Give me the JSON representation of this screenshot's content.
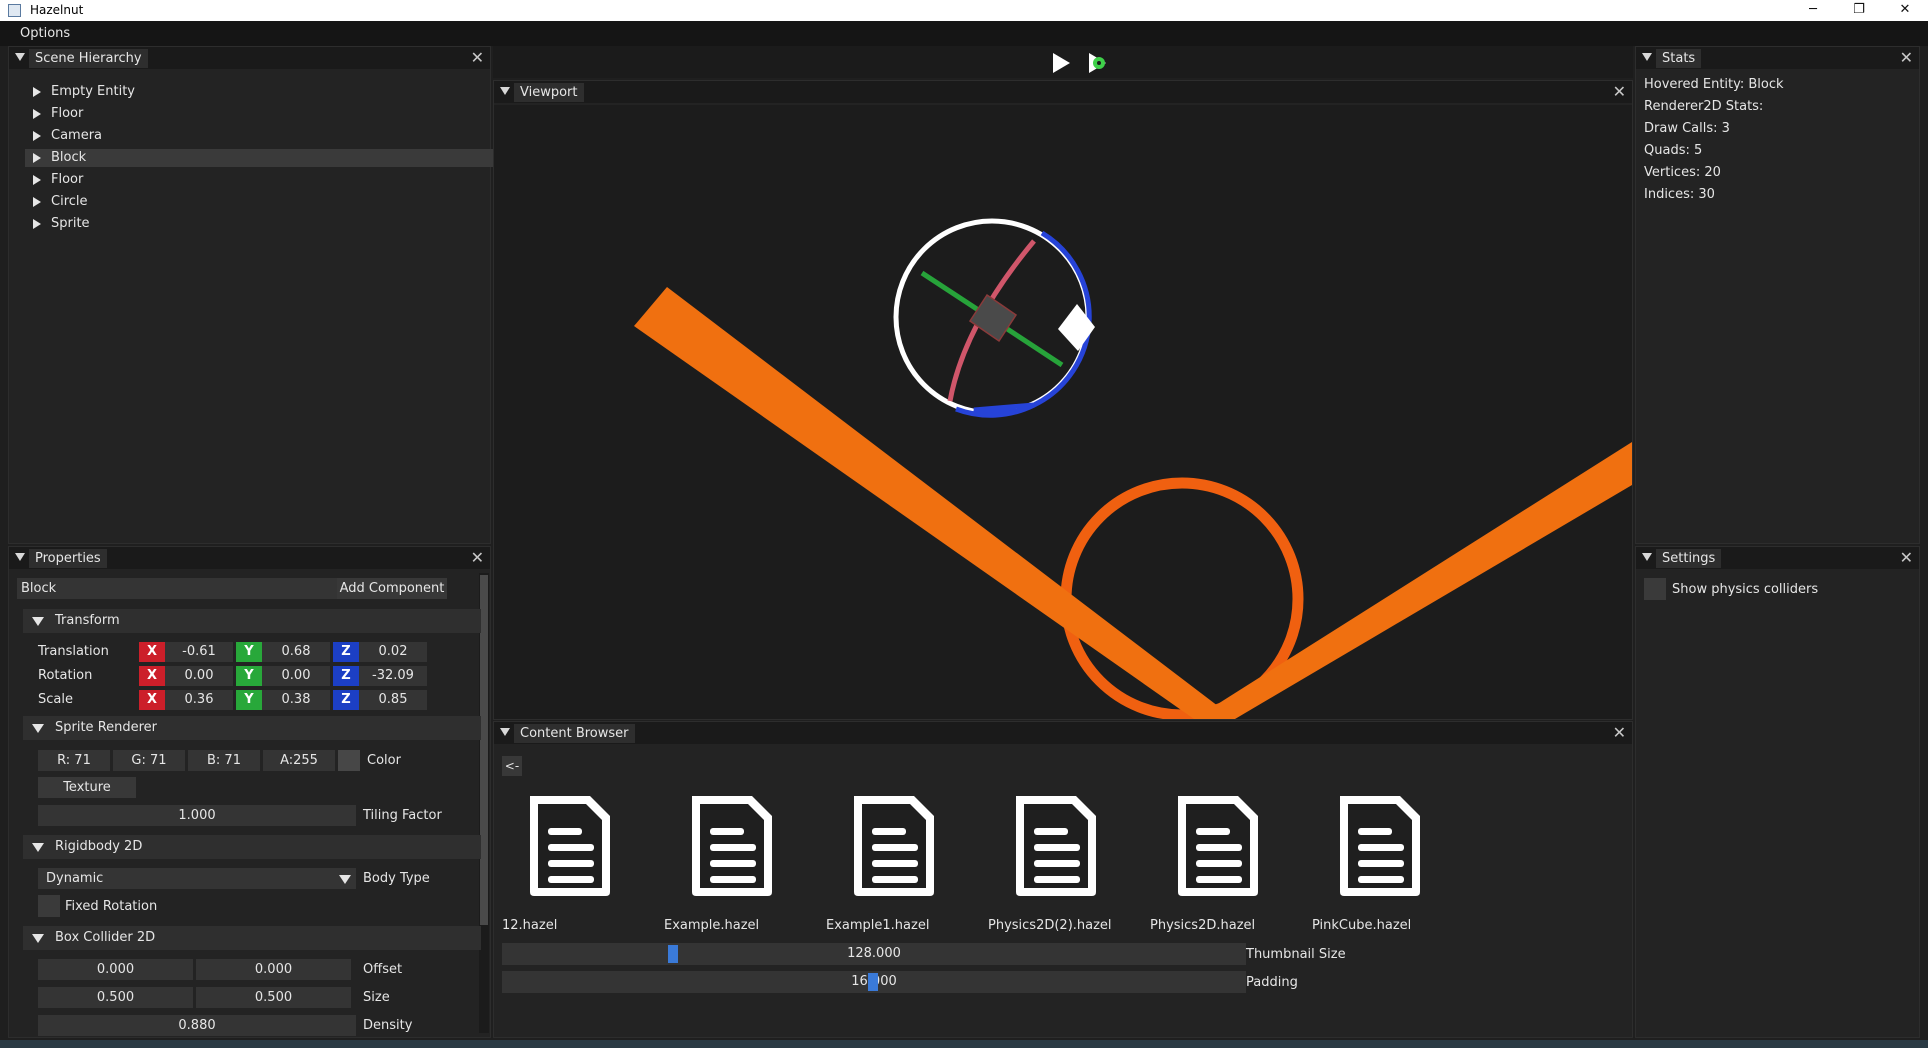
{
  "window": {
    "title": "Hazelnut",
    "minimize_glyph": "─",
    "maximize_glyph": "❐",
    "close_glyph": "✕"
  },
  "menu": {
    "items": [
      "Options"
    ]
  },
  "toolbar": {
    "play_icon": "play-icon",
    "simulate_icon": "simulate-icon"
  },
  "scene_hierarchy": {
    "title": "Scene Hierarchy",
    "items": [
      {
        "label": "Empty Entity",
        "selected": false
      },
      {
        "label": "Floor",
        "selected": false
      },
      {
        "label": "Camera",
        "selected": false
      },
      {
        "label": "Block",
        "selected": true
      },
      {
        "label": "Floor",
        "selected": false
      },
      {
        "label": "Circle",
        "selected": false
      },
      {
        "label": "Sprite",
        "selected": false
      }
    ]
  },
  "properties": {
    "title": "Properties",
    "entity_name": "Block",
    "add_component": "Add Component",
    "transform": {
      "title": "Transform",
      "rows": [
        {
          "label": "Translation",
          "x": "-0.61",
          "y": "0.68",
          "z": "0.02"
        },
        {
          "label": "Rotation",
          "x": "0.00",
          "y": "0.00",
          "z": "-32.09"
        },
        {
          "label": "Scale",
          "x": "0.36",
          "y": "0.38",
          "z": "0.85"
        }
      ],
      "axis_x": "X",
      "axis_y": "Y",
      "axis_z": "Z"
    },
    "sprite_renderer": {
      "title": "Sprite Renderer",
      "r": "R: 71",
      "g": "G: 71",
      "b": "B: 71",
      "a": "A:255",
      "color_label": "Color",
      "swatch_color": "#474747",
      "texture_button": "Texture",
      "tiling_value": "1.000",
      "tiling_label": "Tiling Factor"
    },
    "rigidbody": {
      "title": "Rigidbody 2D",
      "body_type": "Dynamic",
      "body_type_label": "Body Type",
      "fixed_rotation": "Fixed Rotation"
    },
    "box_collider": {
      "title": "Box Collider 2D",
      "offset_x": "0.000",
      "offset_y": "0.000",
      "offset_label": "Offset",
      "size_x": "0.500",
      "size_y": "0.500",
      "size_label": "Size",
      "density": "0.880",
      "density_label": "Density"
    }
  },
  "viewport": {
    "title": "Viewport",
    "colors": {
      "background": "#1c1c1c",
      "floor": "#f07010",
      "circle": "#f06010"
    }
  },
  "content_browser": {
    "title": "Content Browser",
    "back_button": "<-",
    "files": [
      "12.hazel",
      "Example.hazel",
      "Example1.hazel",
      "Physics2D(2).hazel",
      "Physics2D.hazel",
      "PinkCube.hazel"
    ],
    "thumbnail_size": "128.000",
    "thumbnail_label": "Thumbnail Size",
    "padding": "16.000",
    "padding_label": "Padding"
  },
  "stats": {
    "title": "Stats",
    "lines": [
      "Hovered Entity: Block",
      "Renderer2D Stats:",
      "Draw Calls: 3",
      "Quads: 5",
      "Vertices: 20",
      "Indices: 30"
    ]
  },
  "settings": {
    "title": "Settings",
    "show_colliders": "Show physics colliders"
  }
}
